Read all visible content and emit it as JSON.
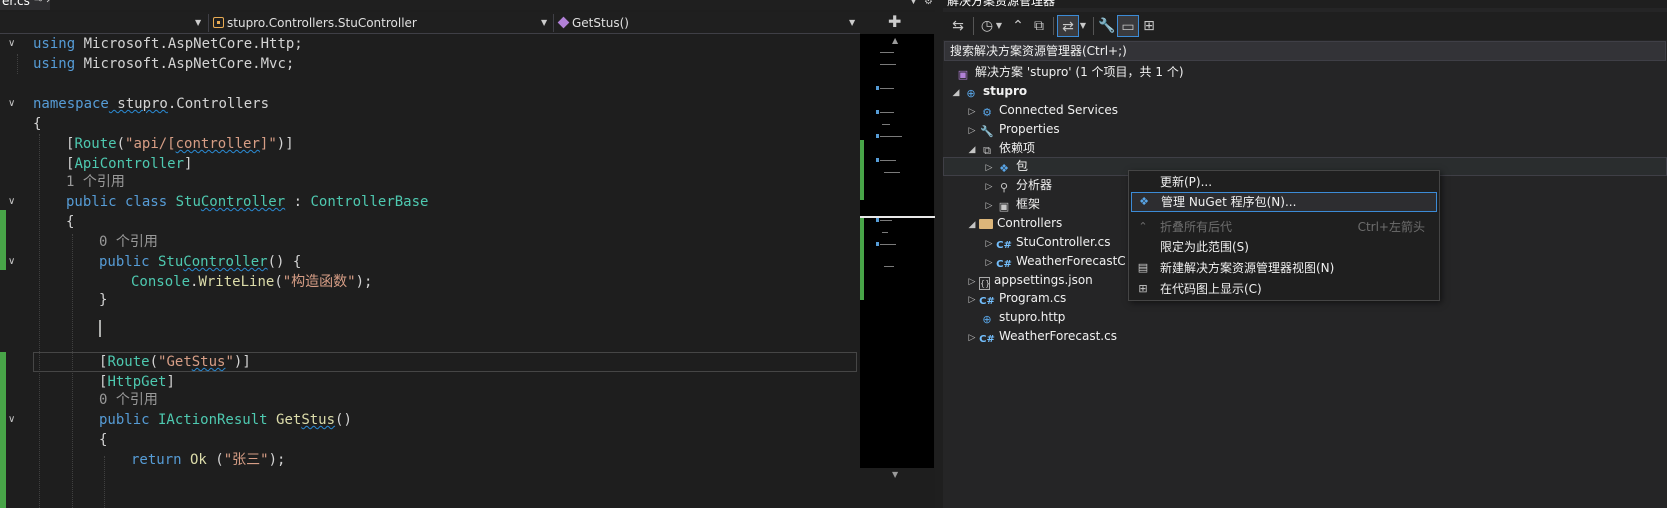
{
  "editor": {
    "doc_tab": {
      "title": "er.cs",
      "icons": "⊸ ✕"
    },
    "nav": {
      "project": "",
      "class": "stupro.Controllers.StuController",
      "member": "GetStus()"
    },
    "code": {
      "line1_kw": "using",
      "line1_ns": " Microsoft.AspNetCore.Http;",
      "line2_kw": "using",
      "line2_ns": " Microsoft.AspNetCore.Mvc;",
      "ns_kw": "namespace",
      "ns_name_a": " stupro",
      "ns_name_b": ".Controllers",
      "open_brace": "{",
      "attr_route_open": "[",
      "attr_route_name": "Route",
      "attr_route_paren": "(",
      "attr_route_str1": "\"api/[",
      "attr_route_str2": "controller",
      "attr_route_str3": "]\"",
      "attr_route_close": ")]",
      "apicontroller_open": "[",
      "apicontroller": "ApiController",
      "apicontroller_close": "]",
      "ref1": "1 个引用",
      "class_kw": "public class",
      "class_name_a": " Stu",
      "class_name_b": "Controller",
      "class_colon": " : ",
      "class_base": "ControllerBase",
      "class_open": "{",
      "ref0a": "0 个引用",
      "ctor_kw": "public",
      "ctor_name_a": " Stu",
      "ctor_name_b": "Controller",
      "ctor_rest": "() {",
      "console_type": "Console",
      "console_dot": ".",
      "console_method": "WriteLine",
      "console_open": "(",
      "console_str": "\"构造函数\"",
      "console_close": ");",
      "ctor_close": "}",
      "route2_open": "[",
      "route2_name": "Route",
      "route2_paren": "(",
      "route2_str_a": "\"Get",
      "route2_str_b": "Stus",
      "route2_str_c": "\"",
      "route2_close": ")]",
      "httpget_open": "[",
      "httpget": "HttpGet",
      "httpget_close": "]",
      "ref0b": "0 个引用",
      "method_kw": "public",
      "method_type": " IActionResult",
      "method_name_a": " Get",
      "method_name_b": "Stus",
      "method_paren": "()",
      "method_open": "{",
      "return_kw": "return",
      "return_ok": " Ok",
      "return_paren": " (",
      "return_str": "\"张三\"",
      "return_close": ");"
    }
  },
  "solution_explorer": {
    "title": "解决方案资源管理器",
    "search_placeholder": "搜索解决方案资源管理器(Ctrl+;)",
    "tree": {
      "solution": "解决方案 'stupro' (1 个项目，共 1 个)",
      "project": "stupro",
      "connected_services": "Connected Services",
      "properties": "Properties",
      "dependencies": "依赖项",
      "packages": "包",
      "analyzers": "分析器",
      "frameworks": "框架",
      "controllers": "Controllers",
      "stucontroller": "StuController.cs",
      "weatherforecastcontroller": "WeatherForecastC",
      "appsettings": "appsettings.json",
      "program": "Program.cs",
      "stupro_http": "stupro.http",
      "weatherforecast": "WeatherForecast.cs"
    }
  },
  "context_menu": {
    "update": "更新(P)...",
    "manage_nuget": "管理 NuGet 程序包(N)...",
    "collapse_all": "折叠所有后代",
    "collapse_all_shortcut": "Ctrl+左箭头",
    "scope_to_this": "限定为此范围(S)",
    "new_view": "新建解决方案资源管理器视图(N)",
    "show_on_code_map": "在代码图上显示(C)"
  },
  "colors": {
    "keyword": "#569cd6",
    "type": "#4ec9b0",
    "string": "#d69d85",
    "method": "#dcdcaa",
    "change_bar": "#48a548",
    "accent": "#3c8bd6"
  }
}
